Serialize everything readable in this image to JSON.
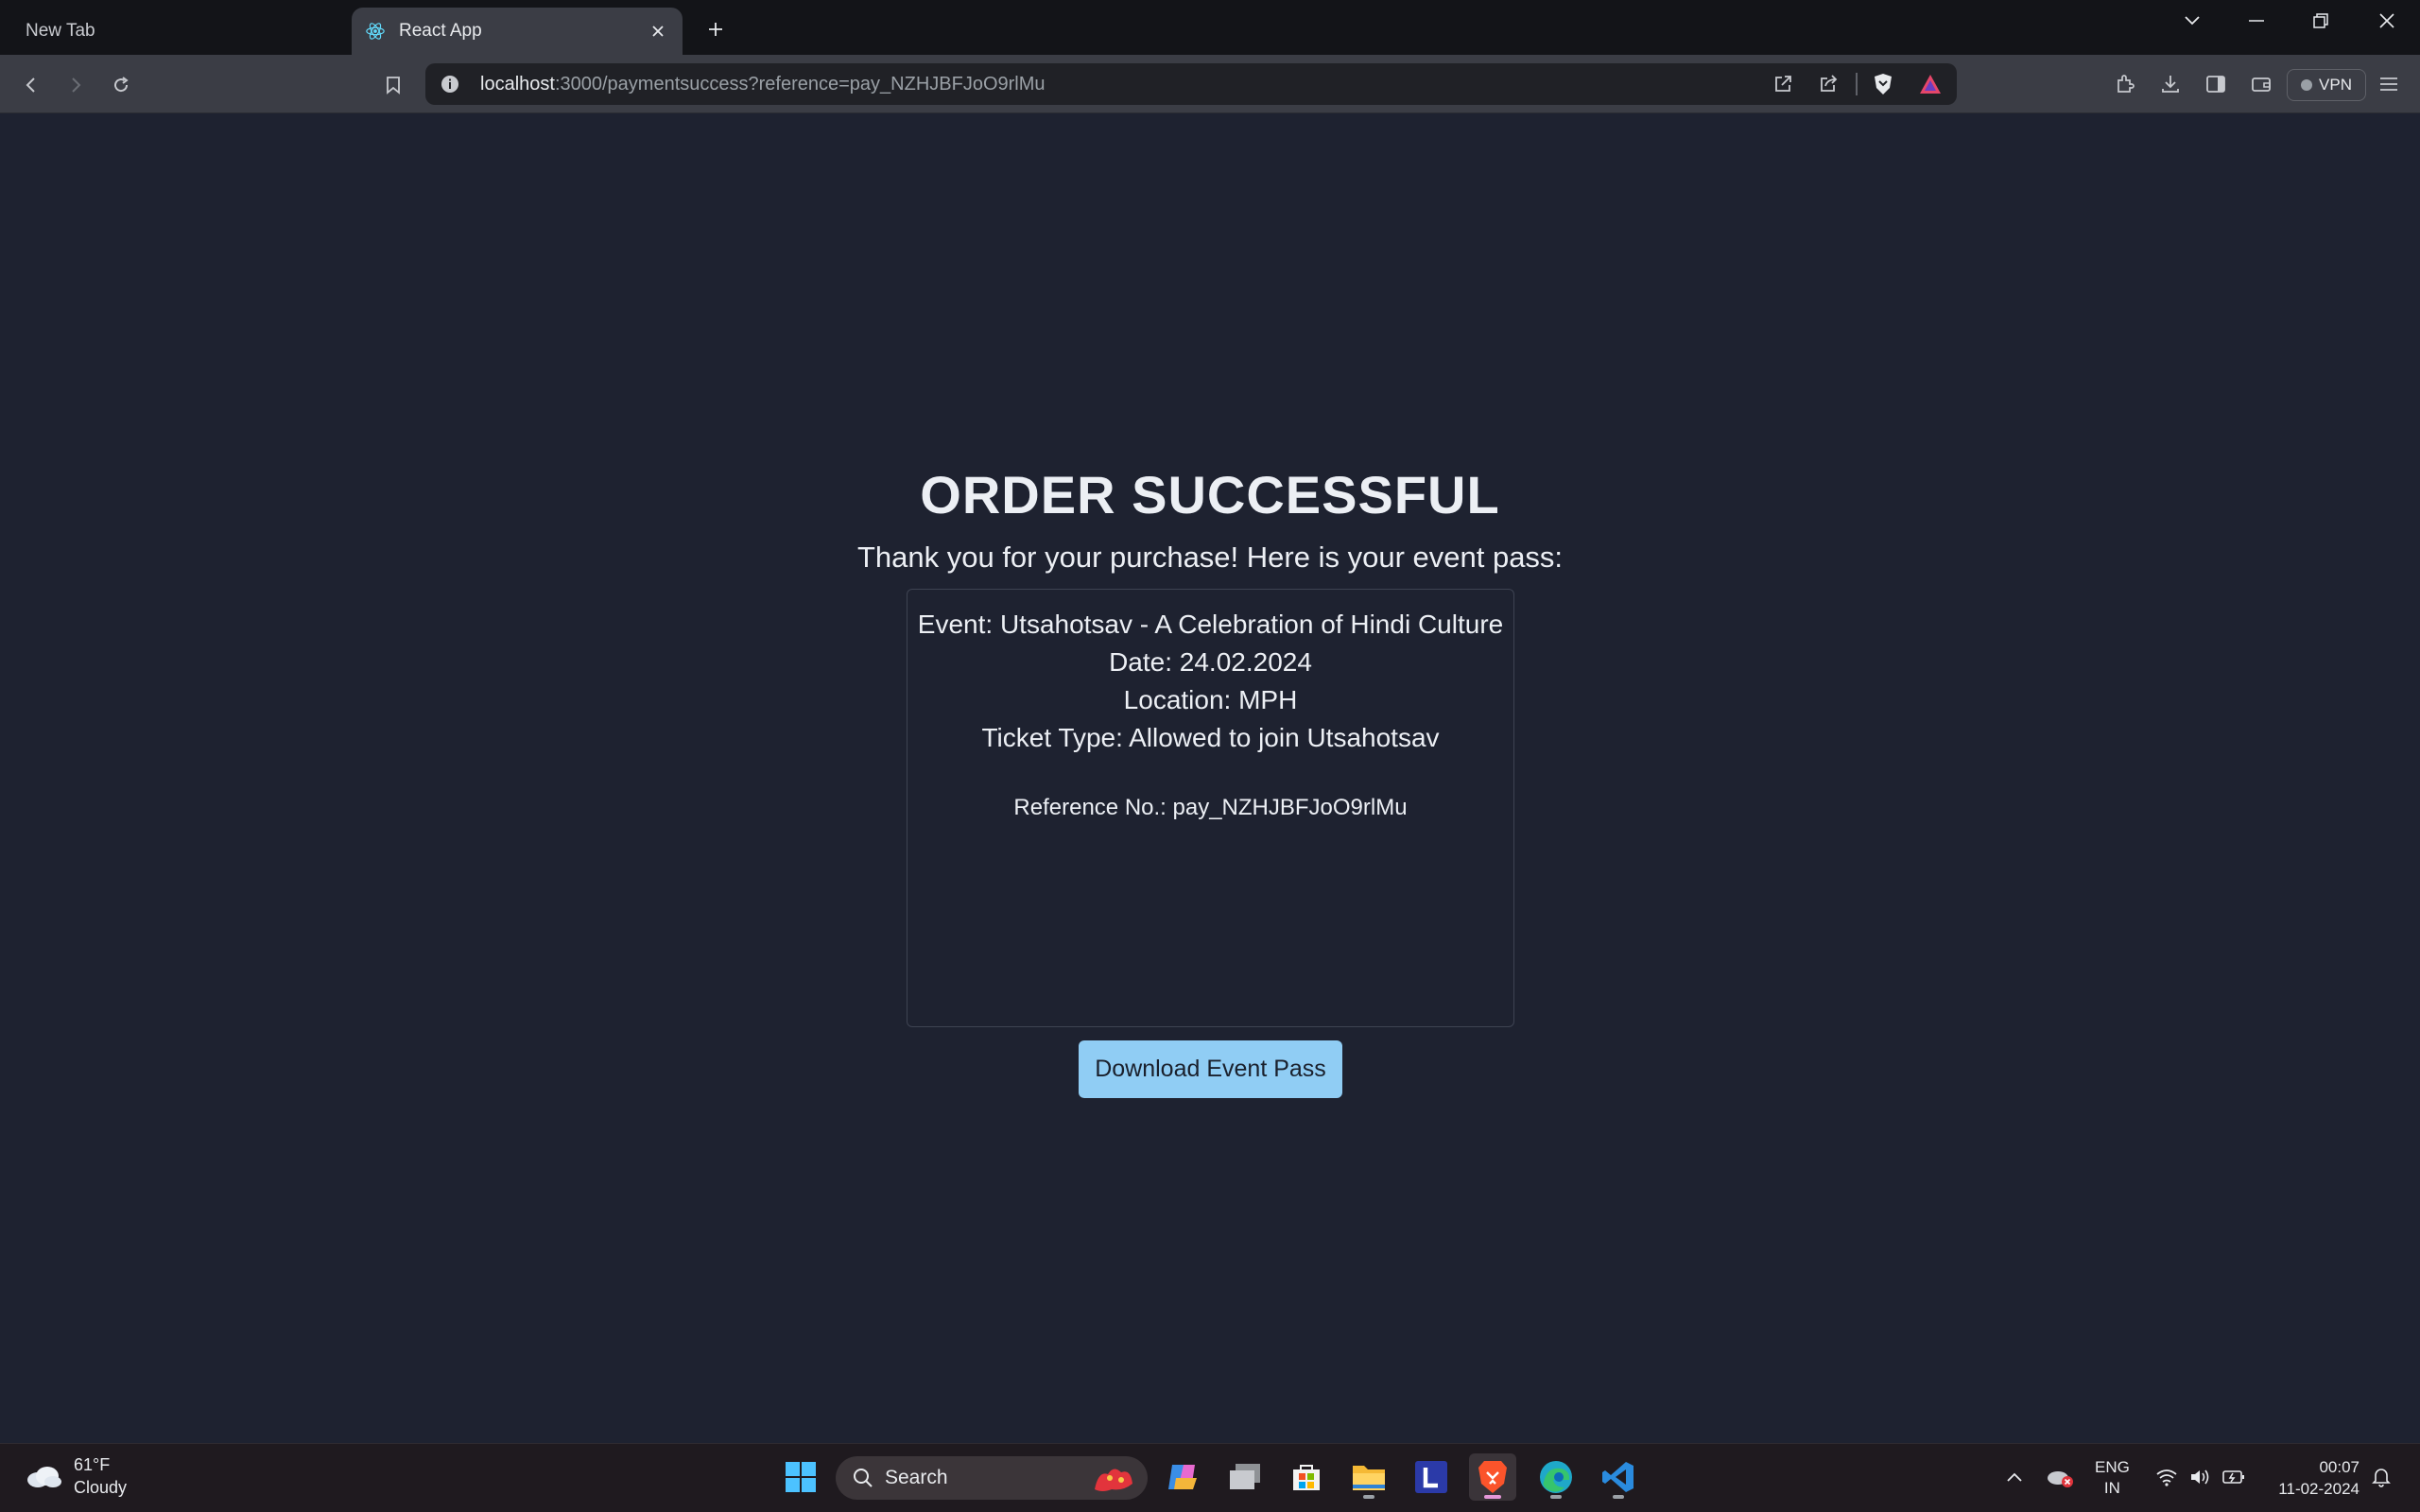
{
  "browser": {
    "tabs": [
      {
        "label": "New Tab",
        "active": false
      },
      {
        "label": "React App",
        "active": true
      }
    ],
    "url_host": "localhost",
    "url_rest": ":3000/paymentsuccess?reference=pay_NZHJBFJoO9rlMu",
    "vpn_label": "VPN"
  },
  "page": {
    "heading": "ORDER SUCCESSFUL",
    "subtitle": "Thank you for your purchase! Here is your event pass:",
    "pass": {
      "event": "Event: Utsahotsav - A Celebration of Hindi Culture",
      "date": "Date: 24.02.2024",
      "location": "Location: MPH",
      "ticket_type": "Ticket Type: Allowed to join Utsahotsav",
      "reference": "Reference No.: pay_NZHJBFJoO9rlMu"
    },
    "download_label": "Download Event Pass",
    "colors": {
      "background": "#1e2230",
      "button": "#90cdf4"
    }
  },
  "taskbar": {
    "weather_temp": "61°F",
    "weather_desc": "Cloudy",
    "search_placeholder": "Search",
    "lang_line1": "ENG",
    "lang_line2": "IN",
    "time": "00:07",
    "date": "11-02-2024",
    "apps": [
      "start-icon",
      "copilot-icon",
      "task-view-icon",
      "store-icon",
      "file-explorer-icon",
      "l-app-icon",
      "brave-icon",
      "edge-icon",
      "vscode-icon"
    ]
  }
}
